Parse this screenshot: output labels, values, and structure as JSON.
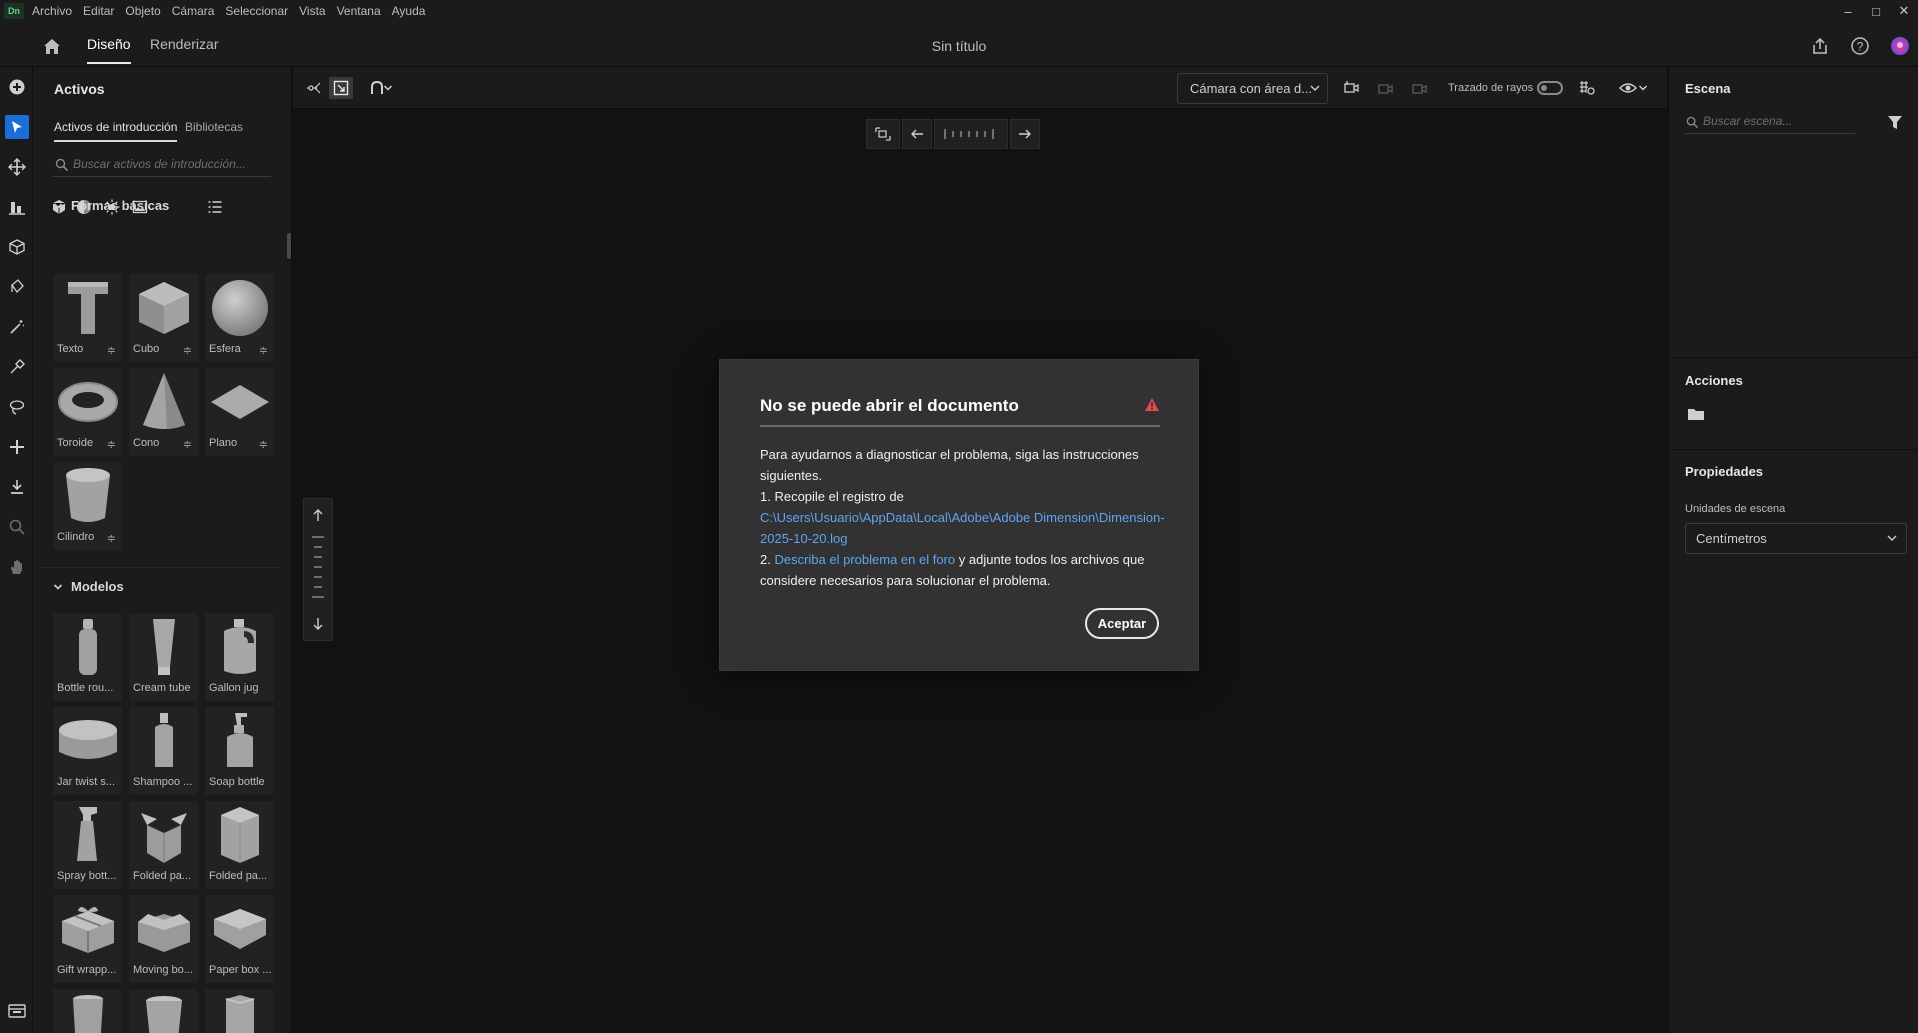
{
  "app": {
    "logo_text": "Dn",
    "menu": [
      "Archivo",
      "Editar",
      "Objeto",
      "Cámara",
      "Seleccionar",
      "Vista",
      "Ventana",
      "Ayuda"
    ],
    "window_controls": {
      "minimize": "–",
      "maximize": "□",
      "close": "✕"
    }
  },
  "header": {
    "tabs": [
      "Diseño",
      "Renderizar"
    ],
    "active_tab": "Diseño",
    "document_title": "Sin título"
  },
  "assets_panel": {
    "title": "Activos",
    "subtabs": [
      "Activos de introducción",
      "Bibliotecas"
    ],
    "search_placeholder": "Buscar activos de introducción...",
    "basic_shapes": {
      "title": "Formas básicas",
      "items": [
        "Texto",
        "Cubo",
        "Esfera",
        "Toroide",
        "Cono",
        "Plano",
        "Cilindro"
      ]
    },
    "models": {
      "title": "Modelos",
      "items": [
        "Bottle rou...",
        "Cream tube",
        "Gallon jug",
        "Jar twist s...",
        "Shampoo ...",
        "Soap bottle",
        "Spray bott...",
        "Folded pa...",
        "Folded pa...",
        "Gift wrapp...",
        "Moving bo...",
        "Paper box ..."
      ]
    }
  },
  "viewport": {
    "camera_select": "Cámara con área d...",
    "raytrace_label": "Trazado de rayos",
    "raytrace_on": false
  },
  "dialog": {
    "title": "No se puede abrir el documento",
    "line1": "Para ayudarnos a diagnosticar el problema, siga las instrucciones siguientes.",
    "line2": "1. Recopile el registro de",
    "log_path": "C:\\Users\\Usuario\\AppData\\Local\\Adobe\\Adobe Dimension\\Dimension-2025-10-20.log",
    "line3_prefix": "2.",
    "forum_link": "Describa el problema en el foro",
    "line3_suffix": "y adjunte todos los archivos que considere necesarios para solucionar el problema.",
    "accept_label": "Aceptar"
  },
  "right_panel": {
    "scene_title": "Escena",
    "scene_search_placeholder": "Buscar escena...",
    "actions_title": "Acciones",
    "properties_title": "Propiedades",
    "units_label": "Unidades de escena",
    "units_value": "Centímetros"
  },
  "colors": {
    "accent": "#1a6fd6",
    "link": "#5ea5f2",
    "warning": "#e34850"
  }
}
